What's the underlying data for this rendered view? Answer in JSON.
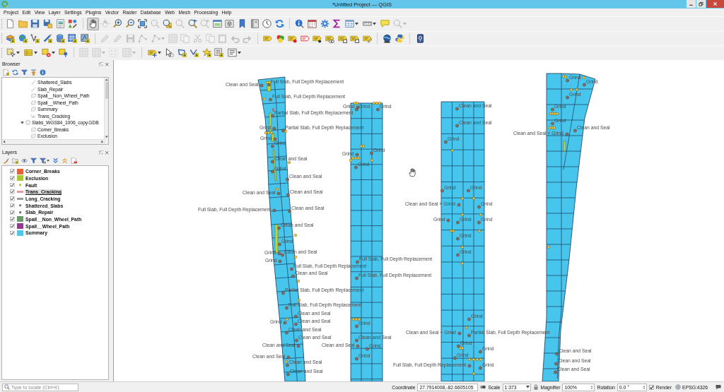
{
  "window": {
    "title": "*Untitled Project — QGIS"
  },
  "menu": [
    "Project",
    "Edit",
    "View",
    "Layer",
    "Settings",
    "Plugins",
    "Vector",
    "Raster",
    "Database",
    "Web",
    "Mesh",
    "Processing",
    "Help"
  ],
  "toolbars": [
    {
      "buttons": [
        {
          "disabled": false,
          "selected": false
        },
        {
          "disabled": false,
          "selected": false
        },
        {
          "disabled": false,
          "selected": false
        },
        {
          "disabled": false,
          "selected": false
        },
        {
          "disabled": false,
          "selected": false
        },
        {
          "disabled": false,
          "selected": false
        },
        {
          "disabled": false,
          "selected": true
        },
        {
          "disabled": true,
          "selected": false
        },
        {
          "disabled": false,
          "selected": false
        },
        {
          "disabled": false,
          "selected": false
        },
        {
          "disabled": false,
          "selected": false
        },
        {
          "disabled": true,
          "selected": false
        },
        {
          "disabled": false,
          "selected": false
        },
        {
          "disabled": true,
          "selected": false
        },
        {
          "disabled": false,
          "selected": false
        },
        {
          "disabled": true,
          "selected": false
        },
        {
          "disabled": false,
          "selected": false
        },
        {
          "disabled": false,
          "selected": false
        },
        {
          "disabled": false,
          "selected": false
        },
        {
          "disabled": false,
          "selected": false
        },
        {
          "disabled": false,
          "selected": false
        },
        {
          "disabled": false,
          "selected": false
        },
        {
          "disabled": false,
          "selected": false
        },
        {
          "disabled": false,
          "selected": false
        },
        {
          "disabled": false,
          "selected": false
        },
        {
          "disabled": false,
          "selected": false
        },
        {
          "disabled": false,
          "selected": false
        },
        {
          "disabled": false,
          "selected": false
        },
        {
          "disabled": false,
          "selected": false
        },
        {
          "disabled": true,
          "selected": false
        }
      ]
    },
    {
      "buttons": [
        {
          "disabled": false,
          "selected": false
        },
        {
          "disabled": false,
          "selected": false
        },
        {
          "disabled": false,
          "selected": false
        },
        {
          "disabled": false,
          "selected": false
        },
        {
          "disabled": false,
          "selected": false
        },
        {
          "disabled": false,
          "selected": false
        },
        {
          "disabled": false,
          "selected": false
        },
        {
          "disabled": true,
          "selected": false
        },
        {
          "disabled": true,
          "selected": false
        },
        {
          "disabled": true,
          "selected": false
        },
        {
          "disabled": true,
          "selected": false
        },
        {
          "disabled": true,
          "selected": false
        },
        {
          "disabled": true,
          "selected": false
        },
        {
          "disabled": true,
          "selected": false
        },
        {
          "disabled": true,
          "selected": false
        },
        {
          "disabled": true,
          "selected": false
        },
        {
          "disabled": true,
          "selected": false
        },
        {
          "disabled": true,
          "selected": false
        },
        {
          "disabled": true,
          "selected": false
        },
        {
          "disabled": false,
          "selected": false
        },
        {
          "disabled": false,
          "selected": false
        },
        {
          "disabled": false,
          "selected": false
        },
        {
          "disabled": false,
          "selected": false
        },
        {
          "disabled": false,
          "selected": false
        },
        {
          "disabled": false,
          "selected": false
        },
        {
          "disabled": false,
          "selected": false
        },
        {
          "disabled": false,
          "selected": false
        },
        {
          "disabled": false,
          "selected": false
        },
        {
          "disabled": false,
          "selected": false
        },
        {
          "disabled": false,
          "selected": false
        },
        {
          "disabled": false,
          "selected": false
        }
      ]
    },
    {
      "buttons": [
        {
          "disabled": false,
          "selected": false
        },
        {
          "disabled": false,
          "selected": false
        },
        {
          "disabled": false,
          "selected": false
        },
        {
          "disabled": false,
          "selected": false
        },
        {
          "disabled": true,
          "selected": false
        },
        {
          "disabled": true,
          "selected": false
        },
        {
          "disabled": true,
          "selected": false
        },
        {
          "disabled": true,
          "selected": false
        },
        {
          "disabled": false,
          "selected": false
        },
        {
          "disabled": false,
          "selected": false
        },
        {
          "disabled": false,
          "selected": false
        },
        {
          "disabled": false,
          "selected": false
        },
        {
          "disabled": false,
          "selected": false
        },
        {
          "disabled": false,
          "selected": false
        },
        {
          "disabled": false,
          "selected": false
        }
      ]
    }
  ],
  "browser": {
    "title": "Browser",
    "items": [
      {
        "label": "Shattered_Slabs",
        "kind": "point"
      },
      {
        "label": "Slab_Repair",
        "kind": "point"
      },
      {
        "label": "Spall__Non_Wheel_Path",
        "kind": "polygon"
      },
      {
        "label": "Spall__Wheel_Path",
        "kind": "polygon"
      },
      {
        "label": "Summary",
        "kind": "polygon"
      },
      {
        "label": "Trans_Cracking",
        "kind": "line"
      },
      {
        "label": "Slabs_WGS84_1006_copy.GDB",
        "kind": "database",
        "expanded": true,
        "children": [
          {
            "label": "Corner_Breaks",
            "kind": "polygon"
          },
          {
            "label": "Exclusion",
            "kind": "polygon"
          }
        ]
      }
    ]
  },
  "layers": {
    "title": "Layers",
    "items": [
      {
        "label": "Corner_Breaks",
        "checked": true,
        "selected": false,
        "kind": "fill",
        "color": "#e4613a"
      },
      {
        "label": "Exclusion",
        "checked": true,
        "selected": false,
        "kind": "fill",
        "color": "#a9c934"
      },
      {
        "label": "Fault",
        "checked": true,
        "selected": false,
        "kind": "point",
        "color": "#b5c43a"
      },
      {
        "label": "Trans_Cracking",
        "checked": true,
        "selected": true,
        "kind": "line",
        "color": "#e49a9a"
      },
      {
        "label": "Long_Cracking",
        "checked": true,
        "selected": false,
        "kind": "line",
        "color": "#9a9a9a"
      },
      {
        "label": "Shattered_Slabs",
        "checked": true,
        "selected": false,
        "kind": "point",
        "color": "#7a7a7a"
      },
      {
        "label": "Slab_Repair",
        "checked": true,
        "selected": false,
        "kind": "point",
        "color": "#6a6a6a"
      },
      {
        "label": "Spall__Non_Wheel_Path",
        "checked": true,
        "selected": false,
        "kind": "fill",
        "color": "#6a9a6a"
      },
      {
        "label": "Spall__Wheel_Path",
        "checked": true,
        "selected": false,
        "kind": "fill",
        "color": "#8e3c8e"
      },
      {
        "label": "Summary",
        "checked": true,
        "selected": false,
        "kind": "fill",
        "color": "#4fc8ec"
      }
    ]
  },
  "map": {
    "segments": [
      {
        "labels": [
          "Clean and Seal",
          "Full Slab, Full Depth Replacement",
          "Full Slab, Full Depth Replacement",
          "Partial Slab, Full Depth Replacement",
          "Grind",
          "Partial Slab, Full Depth Replacement",
          "Grind",
          "Grind",
          "Clean and Seal",
          "Grind",
          "Clean and Seal",
          "Clean and Seal",
          "Clean and Seal",
          "Full Slab, Full Depth Replacement",
          "Clean and Seal",
          "Clean and Seal",
          "Grind",
          "Grind",
          "Clean and Seal",
          "Grind",
          "Full Slab, Full Depth Replacement",
          "Clean and Seal",
          "Partial Slab, Full Depth Replacement",
          "Full Slab, Full Depth Replacement",
          "Clean and Seal",
          "Grind",
          "Clean and Seal",
          "Clean and Seal",
          "Clean and Seal",
          "Clean and Seal",
          "Clean and Seal",
          "Clean and Seal",
          "Clean and Seal"
        ]
      },
      {
        "labels": [
          "Grind",
          "Grind",
          "Grind",
          "Grind",
          "Grind",
          "Grind",
          "Full Slab, Full Depth Replacement",
          "Full Slab, Full Depth Replacement",
          "Grind",
          "Clean and Seal",
          "Clean and Seal",
          "Grind",
          "Grind"
        ]
      },
      {
        "labels": [
          "Clean and Seal",
          "Clean and Seal",
          "Grind",
          "Grind",
          "Grind",
          "Clean and Seal + Grind",
          "Grind",
          "Grind",
          "Grind",
          "Grind",
          "Grind",
          "Grind",
          "Grind",
          "Clean and Seal + Grind",
          "Partial Slab, Full Depth Replacement",
          "Grind",
          "Grind",
          "Grind",
          "Full Slab, Full Depth Replacement",
          "Grind"
        ]
      },
      {
        "labels": [
          "Grind",
          "Grind",
          "Grind",
          "Grind",
          "Grind",
          "Clean and Seal",
          "Clean and Seal + Grind",
          "Clean and Seal",
          "Clean and Seal",
          "Clean and Seal"
        ]
      }
    ]
  },
  "status_bar": {
    "locator": {
      "placeholder": "Type to locate (Ctrl+K)"
    },
    "coordinate": {
      "label": "Coordinate",
      "value": "27.7914008,-82.6605105"
    },
    "scale": {
      "label": "Scale",
      "value": "1:373"
    },
    "magnifier": {
      "label": "Magnifier",
      "value": "100%"
    },
    "rotation": {
      "label": "Rotation",
      "value": "0.0 °"
    },
    "render": {
      "label": "Render",
      "checked": true
    },
    "crs": "EPSG:4326"
  }
}
